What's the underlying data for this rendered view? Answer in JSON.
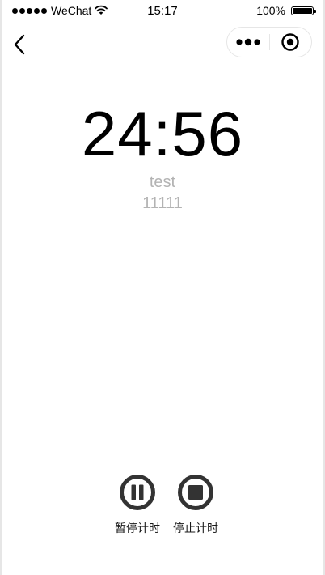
{
  "status_bar": {
    "carrier": "WeChat",
    "time": "15:17",
    "battery_percent": "100%",
    "battery_level": 1.0,
    "signal_bars": 5
  },
  "nav": {
    "back_icon": "chevron-left-icon",
    "menu_icon": "more-dots-icon",
    "close_icon": "target-circle-icon"
  },
  "timer": {
    "display": "24:56",
    "title": "test",
    "note": "11111"
  },
  "controls": {
    "pause_label": "暂停计时",
    "stop_label": "停止计时",
    "icon_color": "#333333"
  }
}
